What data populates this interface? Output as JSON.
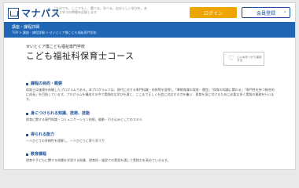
{
  "header": {
    "logo_text": "マナパス",
    "tagline": "「たのでも、ここでも」、選べる。学べる。自分らしい学びを。あなたと学ぶの時間を応援します",
    "login_label": "ログイン",
    "register_label": "会員登録"
  },
  "band": {
    "title": "講座・課程詳細",
    "breadcrumb": "TOP > 講座・課程詳細 > せいとくア僕こども福祉専門学校"
  },
  "course": {
    "school_name": "せいとくア僕こども福祉専門学校",
    "title": "こども福祉科保育士コース",
    "fav_label": "いいねをつけて保存する"
  },
  "sections": [
    {
      "heading": "課程の目的・概要",
      "body": "保育士は価値を体験したプログラムである。本プログラムでは、現代に対する専門知識・技術等を習得し「準教育課の保育・運営」「保育の知識に関わる」「専門性を持つ総合的に成長」を目指しています。プログラムを構成する中で実践的な学びを通じ、ここまで正しく社会に対応する力を養い、保育を身に付けるために必要な多く実践の業務を行います。"
    },
    {
      "heading": "身につけられる知識、技術、技能",
      "body": "保育に関する専門知識・コミュニケーション技術、能動・引き込みとしてのスキル"
    },
    {
      "heading": "得られる能力",
      "body": "一人ひとりの多様性を理解し、一人ひとりに寄り添う力"
    },
    {
      "heading": "教育課程",
      "body": "保育や子どもに関する知識を学習する授業、保育所・施設での実習を通して実践力を高めていきます。"
    }
  ],
  "colors": {
    "brand_blue": "#1a4f9c",
    "band_blue": "#1f66b5",
    "login_orange": "#f0a400"
  }
}
